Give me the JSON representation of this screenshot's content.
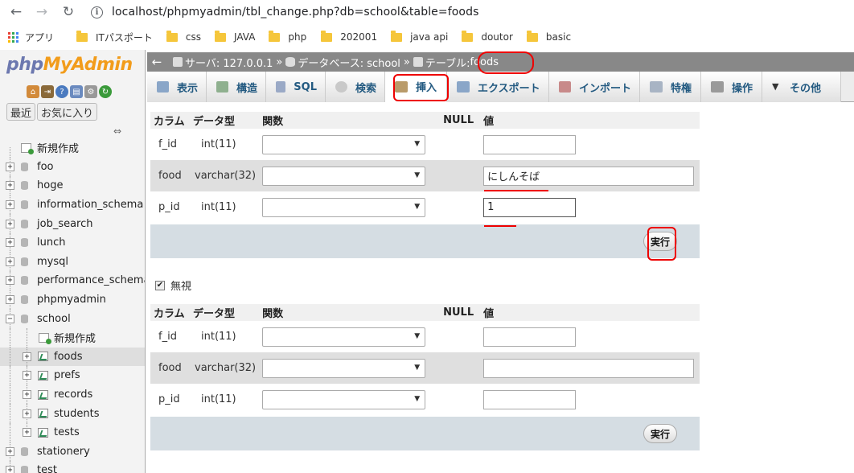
{
  "browser": {
    "url": "localhost/phpmyadmin/tbl_change.php?db=school&table=foods",
    "apps_label": "アプリ",
    "bookmarks": [
      "ITパスポート",
      "css",
      "JAVA",
      "php",
      "202001",
      "java api",
      "doutor",
      "basic"
    ]
  },
  "sidebar": {
    "logo_php": "php",
    "logo_myadmin": "MyAdmin",
    "recent_label": "最近",
    "favorites_label": "お気に入り",
    "new_label": "新規作成",
    "databases": [
      "foo",
      "hoge",
      "information_schema",
      "job_search",
      "lunch",
      "mysql",
      "performance_schema",
      "phpmyadmin"
    ],
    "current_db": "school",
    "school_new_label": "新規作成",
    "school_tables": [
      "foods",
      "prefs",
      "records",
      "students",
      "tests"
    ],
    "after_dbs": [
      "stationery",
      "test"
    ]
  },
  "breadcrumb": {
    "server": "サーバ: 127.0.0.1",
    "database": "データベース: school",
    "table_prefix": "テーブル: ",
    "table": "foods",
    "sep": "»"
  },
  "tabs": [
    "表示",
    "構造",
    "SQL",
    "検索",
    "挿入",
    "エクスポート",
    "インポート",
    "特権",
    "操作",
    "その他"
  ],
  "form": {
    "headers": {
      "column": "カラム",
      "type": "データ型",
      "function": "関数",
      "null": "NULL",
      "value": "値"
    },
    "rows": [
      {
        "name": "f_id",
        "type": "int(11)"
      },
      {
        "name": "food",
        "type": "varchar(32)"
      },
      {
        "name": "p_id",
        "type": "int(11)"
      }
    ],
    "values_first": [
      "",
      "にしんそば",
      "1"
    ],
    "go_label": "実行",
    "ignore_label": "無視",
    "ignore_checked": "✔"
  },
  "colors": {
    "annotation": "#e00000",
    "breadcrumb_bg": "#888888",
    "link": "#235a81"
  }
}
